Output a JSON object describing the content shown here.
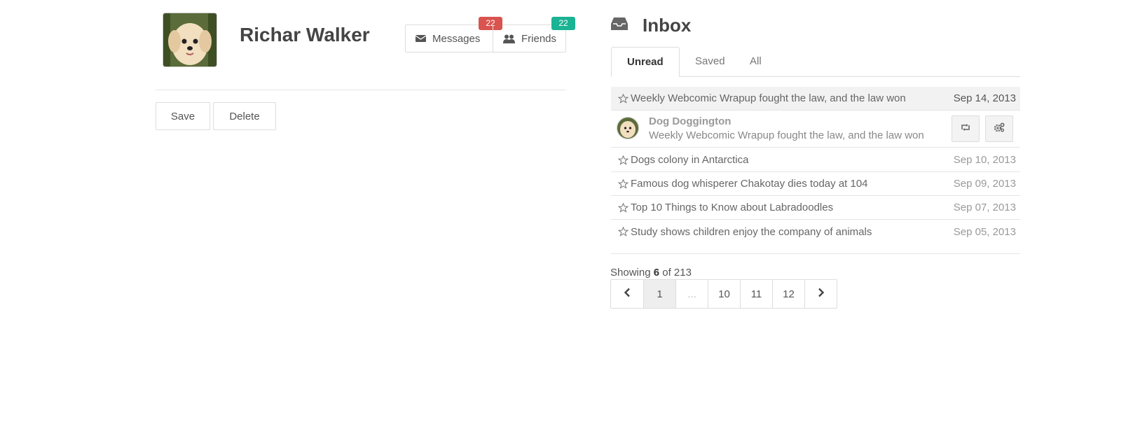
{
  "profile": {
    "name": "Richar Walker",
    "avatar_icon": "puppy-photo",
    "messages_label": "Messages",
    "messages_count": "22",
    "friends_label": "Friends",
    "friends_count": "22",
    "save_label": "Save",
    "delete_label": "Delete"
  },
  "inbox": {
    "title": "Inbox",
    "tabs": [
      "Unread",
      "Saved",
      "All"
    ],
    "active_tab": "Unread",
    "messages": [
      {
        "subject": "Weekly Webcomic Wrapup fought the law, and the law won",
        "date": "Sep 14, 2013",
        "highlighted": true
      },
      {
        "subject": "Dogs colony in Antarctica",
        "date": "Sep 10, 2013"
      },
      {
        "subject": "Famous dog whisperer Chakotay dies today at 104",
        "date": "Sep 09, 2013"
      },
      {
        "subject": "Top 10 Things to Know about Labradoodles",
        "date": "Sep 07, 2013"
      },
      {
        "subject": "Study shows children enjoy the company of animals",
        "date": "Sep 05, 2013"
      }
    ],
    "preview": {
      "sender": "Dog Doggington",
      "text": "Weekly Webcomic Wrapup fought the law, and the law won"
    },
    "showing": {
      "prefix": "Showing ",
      "count": "6",
      "suffix": " of 213"
    },
    "pagination": {
      "pages": [
        "1",
        "...",
        "10",
        "11",
        "12"
      ],
      "active": "1"
    }
  },
  "colors": {
    "badge_red": "#d9534f",
    "badge_teal": "#1ab394"
  }
}
